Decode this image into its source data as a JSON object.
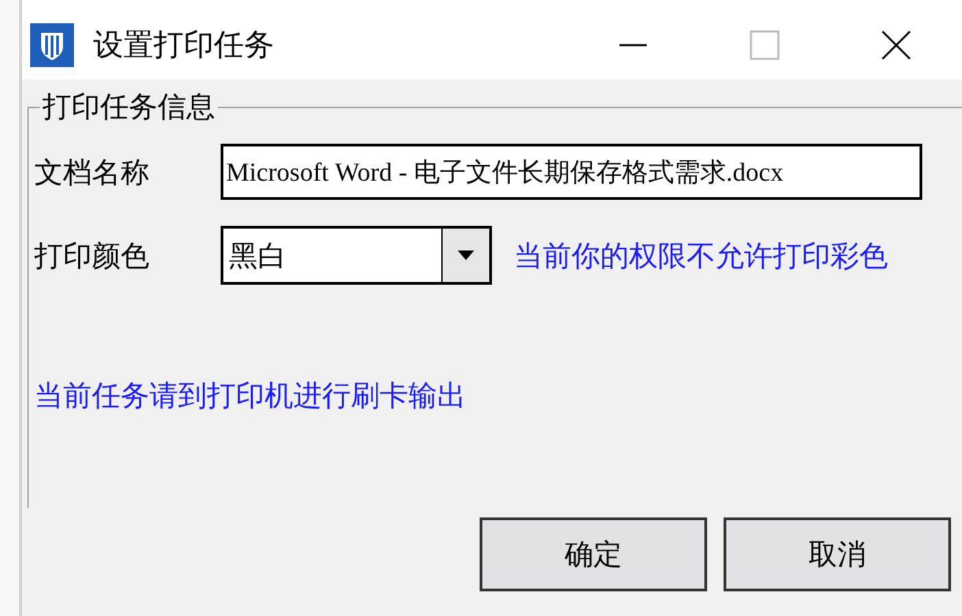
{
  "window": {
    "title": "设置打印任务"
  },
  "group": {
    "title": "打印任务信息"
  },
  "document_name": {
    "label": "文档名称",
    "value": "Microsoft Word - 电子文件长期保存格式需求.docx"
  },
  "print_color": {
    "label": "打印颜色",
    "value": "黑白",
    "note": "当前你的权限不允许打印彩色"
  },
  "message": "当前任务请到打印机进行刷卡输出",
  "buttons": [
    "确定",
    "取消"
  ]
}
